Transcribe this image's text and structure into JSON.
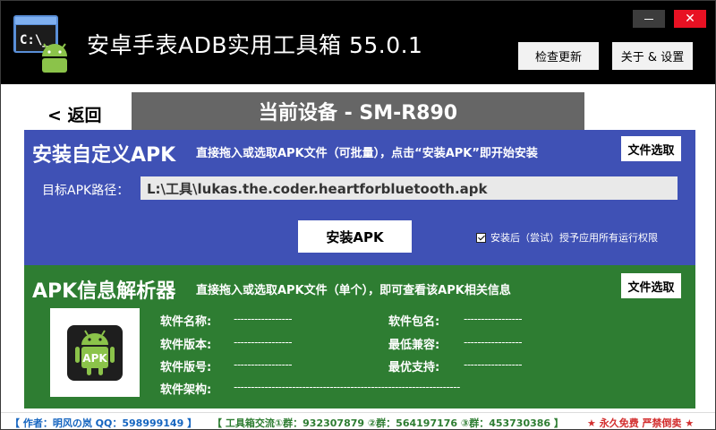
{
  "window": {
    "title": "安卓手表ADB实用工具箱  55.0.1",
    "minimize_label": "—",
    "close_label": "✕",
    "check_update_label": "检查更新",
    "about_label": "关于 & 设置"
  },
  "device": {
    "back_label": "< 返回",
    "current_device": "当前设备 - SM-R890"
  },
  "install": {
    "title": "安装自定义APK",
    "description": "直接拖入或选取APK文件（可批量），点击“安装APK”即开始安装",
    "file_select_label": "文件选取",
    "path_label": "目标APK路径：",
    "path_value": "L:\\工具\\lukas.the.coder.heartforbluetooth.apk",
    "install_button_label": "安装APK",
    "grant_label": "安装后（尝试）授予应用所有运行权限",
    "grant_checked": true
  },
  "apk_info": {
    "title": "APK信息解析器",
    "description": "直接拖入或选取APK文件（单个），即可查看该APK相关信息",
    "file_select_label": "文件选取",
    "logo_text": "APK",
    "fields": {
      "name_label": "软件名称:",
      "name_value": "-----------------",
      "package_label": "软件包名:",
      "package_value": "-----------------",
      "version_label": "软件版本:",
      "version_value": "-----------------",
      "min_compat_label": "最低兼容:",
      "min_compat_value": "-----------------",
      "version_code_label": "软件版号:",
      "version_code_value": "-----------------",
      "target_label": "最优支持:",
      "target_value": "-----------------",
      "arch_label": "软件架构:",
      "arch_value": "------------------------------------------------------------------"
    }
  },
  "status": {
    "author": "【 作者：明风の岚  QQ：598999149 】",
    "groups": "【 工具箱交流①群：932307879  ②群：564197176  ③群：453730386 】",
    "free": "★ 永久免费 严禁倒卖 ★"
  },
  "colors": {
    "titlebar": "#000000",
    "device_bar": "#666666",
    "install_bg": "#3f51b5",
    "apk_bg": "#2e7d32",
    "close_red": "#e81123"
  }
}
